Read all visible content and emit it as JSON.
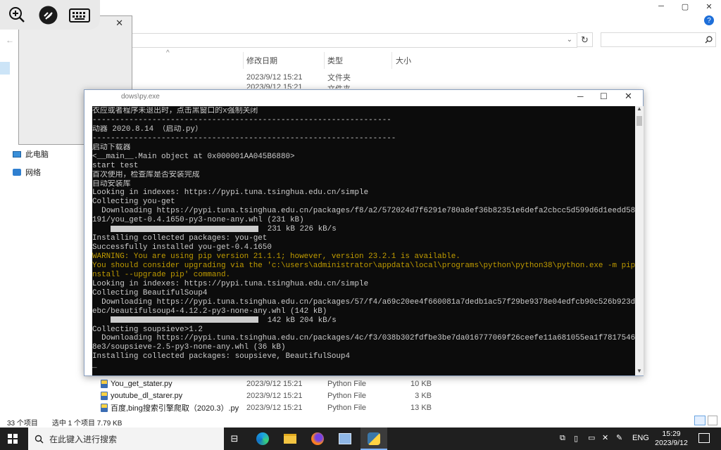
{
  "explorer": {
    "title_controls": {
      "min": "─",
      "max": "▢",
      "close": "✕"
    },
    "help": "?",
    "columns": {
      "date": "修改日期",
      "type": "类型",
      "size": "大小"
    },
    "nav": [
      {
        "label": "此电脑",
        "icon": "computer-icon"
      },
      {
        "label": "网络",
        "icon": "network-icon"
      }
    ],
    "top_rows": [
      {
        "date": "2023/9/12 15:21",
        "type": "文件夹"
      },
      {
        "date": "2023/9/12 15:21",
        "type": "文件夹"
      }
    ],
    "files": [
      {
        "name": "You_get_stater.py",
        "date": "2023/9/12 15:21",
        "type": "Python File",
        "size": "10 KB"
      },
      {
        "name": "youtube_dl_starer.py",
        "date": "2023/9/12 15:21",
        "type": "Python File",
        "size": "3 KB"
      },
      {
        "name": "百度,bing搜索引擎爬取（2020.3）.py",
        "date": "2023/9/12 15:21",
        "type": "Python File",
        "size": "13 KB"
      }
    ],
    "status": {
      "count": "33 个项目",
      "selected": "选中 1 个项目  7.79 KB"
    }
  },
  "console": {
    "title": "dows\\py.exe",
    "lines": [
      {
        "t": "衣应或者程序未退出时，点击黑窗口的x强制关闭"
      },
      {
        "t": "-----------------------------------------------------------------"
      },
      {
        "t": "动器 2020.8.14 （启动.py）"
      },
      {
        "t": "------------------------------------------------------------------"
      },
      {
        "t": "启动下载器"
      },
      {
        "t": "<__main__.Main object at 0x000001AA045B6880>"
      },
      {
        "t": "start test"
      },
      {
        "t": "首次使用，检查库是否安装完成"
      },
      {
        "t": "自动安装库"
      },
      {
        "t": "Looking in indexes: https://pypi.tuna.tsinghua.edu.cn/simple"
      },
      {
        "t": "Collecting you-get"
      },
      {
        "t": "  Downloading https://pypi.tuna.tsinghua.edu.cn/packages/f8/a2/572024d7f6291e780a8ef36b82351e6defa2cbcc5d599d6d1eedd5803"
      },
      {
        "t": "191/you_get-0.4.1650-py3-none-any.whl (231 kB)"
      },
      {
        "t": " 231 kB 226 kB/s",
        "bar": true
      },
      {
        "t": "Installing collected packages: you-get"
      },
      {
        "t": "Successfully installed you-get-0.4.1650"
      },
      {
        "t": "WARNING: You are using pip version 21.1.1; however, version 23.2.1 is available.",
        "warn": true
      },
      {
        "t": "You should consider upgrading via the 'c:\\users\\administrator\\appdata\\local\\programs\\python\\python38\\python.exe -m pip i",
        "warn": true
      },
      {
        "t": "nstall --upgrade pip' command.",
        "warn": true
      },
      {
        "t": "Looking in indexes: https://pypi.tuna.tsinghua.edu.cn/simple"
      },
      {
        "t": "Collecting BeautifulSoup4"
      },
      {
        "t": "  Downloading https://pypi.tuna.tsinghua.edu.cn/packages/57/f4/a69c20ee4f660081a7dedb1ac57f29be9378e04edfcb90c526b923d4b"
      },
      {
        "t": "ebc/beautifulsoup4-4.12.2-py3-none-any.whl (142 kB)"
      },
      {
        "t": " 142 kB 204 kB/s",
        "bar": true
      },
      {
        "t": "Collecting soupsieve>1.2"
      },
      {
        "t": "  Downloading https://pypi.tuna.tsinghua.edu.cn/packages/4c/f3/038b302fdfbe3be7da016777069f26ceefe11a681055ea1f781754650"
      },
      {
        "t": "8e3/soupsieve-2.5-py3-none-any.whl (36 kB)"
      },
      {
        "t": "Installing collected packages: soupsieve, BeautifulSoup4"
      },
      {
        "t": "_"
      }
    ]
  },
  "taskbar": {
    "search_placeholder": "在此键入进行搜索",
    "lang": "ENG",
    "time": "15:29",
    "date": "2023/9/12"
  }
}
